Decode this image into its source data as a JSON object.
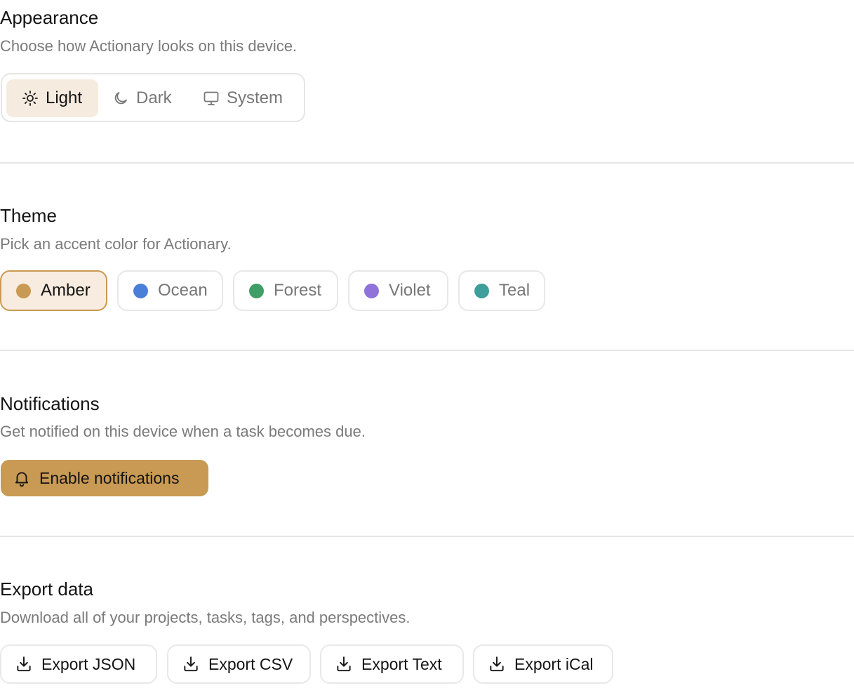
{
  "appearance": {
    "title": "Appearance",
    "description": "Choose how Actionary looks on this device.",
    "options": [
      {
        "label": "Light",
        "icon": "sun-icon",
        "selected": true
      },
      {
        "label": "Dark",
        "icon": "moon-icon",
        "selected": false
      },
      {
        "label": "System",
        "icon": "monitor-icon",
        "selected": false
      }
    ]
  },
  "theme": {
    "title": "Theme",
    "description": "Pick an accent color for Actionary.",
    "options": [
      {
        "label": "Amber",
        "color": "#C99A53",
        "selected": true
      },
      {
        "label": "Ocean",
        "color": "#4A7FD8",
        "selected": false
      },
      {
        "label": "Forest",
        "color": "#3F9E66",
        "selected": false
      },
      {
        "label": "Violet",
        "color": "#8F73DB",
        "selected": false
      },
      {
        "label": "Teal",
        "color": "#3E9E9B",
        "selected": false
      }
    ]
  },
  "notifications": {
    "title": "Notifications",
    "description": "Get notified on this device when a task becomes due.",
    "button_label": "Enable notifications",
    "button_icon": "bell-icon",
    "accent": "#C99A53"
  },
  "export": {
    "title": "Export data",
    "description": "Download all of your projects, tasks, tags, and perspectives.",
    "buttons": [
      {
        "label": "Export JSON",
        "icon": "download-icon"
      },
      {
        "label": "Export CSV",
        "icon": "download-icon"
      },
      {
        "label": "Export Text",
        "icon": "download-icon"
      },
      {
        "label": "Export iCal",
        "icon": "download-icon"
      }
    ]
  }
}
